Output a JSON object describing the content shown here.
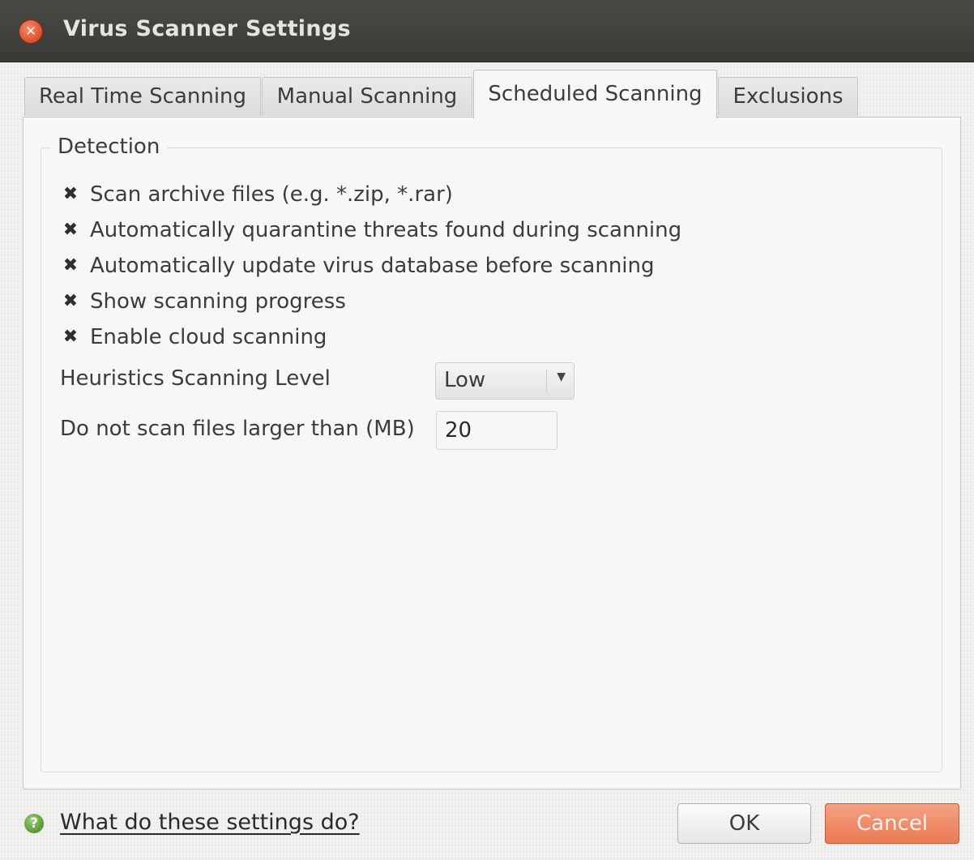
{
  "window": {
    "title": "Virus Scanner Settings",
    "close_icon": "close-icon"
  },
  "tabs": [
    {
      "label": "Real Time Scanning",
      "active": false
    },
    {
      "label": "Manual Scanning",
      "active": false
    },
    {
      "label": "Scheduled Scanning",
      "active": true
    },
    {
      "label": "Exclusions",
      "active": false
    }
  ],
  "detection": {
    "label": "Detection",
    "options": [
      {
        "label": "Scan archive files (e.g. *.zip, *.rar)",
        "checked": true
      },
      {
        "label": "Automatically quarantine threats found during scanning",
        "checked": true
      },
      {
        "label": "Automatically update virus database before scanning",
        "checked": true
      },
      {
        "label": "Show scanning progress",
        "checked": true
      },
      {
        "label": "Enable cloud scanning",
        "checked": true
      }
    ],
    "heuristics_label": "Heuristics Scanning Level",
    "heuristics_value": "Low",
    "max_size_label": "Do not scan files larger than (MB)",
    "max_size_value": "20"
  },
  "footer": {
    "help_text": "What do these settings do?",
    "help_icon": "help-icon",
    "ok_label": "OK",
    "cancel_label": "Cancel"
  },
  "colors": {
    "titlebar": "#3f3e3a",
    "close_button": "#e2572e",
    "cancel_button": "#ea7a52",
    "help_icon": "#5c9e31"
  }
}
